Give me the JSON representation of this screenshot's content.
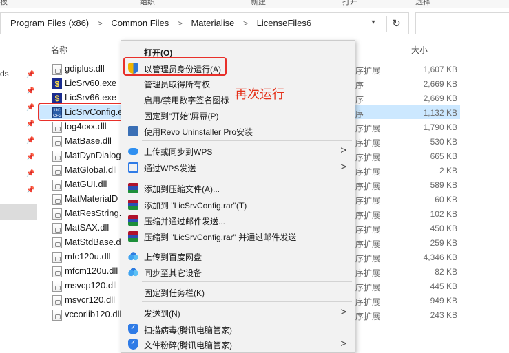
{
  "ribbon": {
    "items": [
      "板",
      "组织",
      "新建",
      "打开",
      "选择"
    ]
  },
  "address": {
    "crumbs": [
      "Program Files (x86)",
      "Common Files",
      "Materialise",
      "LicenseFiles6"
    ],
    "separator": ">",
    "dropdown_icon": "chevron-down-icon",
    "refresh_icon": "refresh-icon"
  },
  "nav": {
    "partial_label": "ds"
  },
  "columns": {
    "name": "名称",
    "size": "大小"
  },
  "files": [
    {
      "name": "gdiplus.dll",
      "icon": "dll-file-icon",
      "type": "序扩展",
      "size": "1,607 KB"
    },
    {
      "name": "LicSrv60.exe",
      "icon": "exe-file-icon",
      "type": "序",
      "size": "2,669 KB"
    },
    {
      "name": "LicSrv66.exe",
      "icon": "exe-file-icon",
      "type": "序",
      "size": "2,669 KB"
    },
    {
      "name": "LicSrvConfig.e",
      "icon": "licsrvconfig-icon",
      "type": "序",
      "size": "1,132 KB"
    },
    {
      "name": "log4cxx.dll",
      "icon": "dll-file-icon",
      "type": "序扩展",
      "size": "1,790 KB"
    },
    {
      "name": "MatBase.dll",
      "icon": "dll-file-icon",
      "type": "序扩展",
      "size": "530 KB"
    },
    {
      "name": "MatDynDialog",
      "icon": "dll-file-icon",
      "type": "序扩展",
      "size": "665 KB"
    },
    {
      "name": "MatGlobal.dll",
      "icon": "dll-file-icon",
      "type": "序扩展",
      "size": "2 KB"
    },
    {
      "name": "MatGUI.dll",
      "icon": "dll-file-icon",
      "type": "序扩展",
      "size": "589 KB"
    },
    {
      "name": "MatMaterialD",
      "icon": "dll-file-icon",
      "type": "序扩展",
      "size": "60 KB"
    },
    {
      "name": "MatResString.",
      "icon": "dll-file-icon",
      "type": "序扩展",
      "size": "102 KB"
    },
    {
      "name": "MatSAX.dll",
      "icon": "dll-file-icon",
      "type": "序扩展",
      "size": "450 KB"
    },
    {
      "name": "MatStdBase.d",
      "icon": "dll-file-icon",
      "type": "序扩展",
      "size": "259 KB"
    },
    {
      "name": "mfc120u.dll",
      "icon": "dll-file-icon",
      "type": "序扩展",
      "size": "4,346 KB"
    },
    {
      "name": "mfcm120u.dll",
      "icon": "dll-file-icon",
      "type": "序扩展",
      "size": "82 KB"
    },
    {
      "name": "msvcp120.dll",
      "icon": "dll-file-icon",
      "type": "序扩展",
      "size": "445 KB"
    },
    {
      "name": "msvcr120.dll",
      "icon": "dll-file-icon",
      "type": "序扩展",
      "size": "949 KB"
    },
    {
      "name": "vccorlib120.dll",
      "icon": "dll-file-icon",
      "type": "序扩展",
      "size": "243 KB"
    }
  ],
  "context_menu": {
    "items": [
      {
        "label": "打开(O)",
        "bold": true
      },
      {
        "label": "以管理员身份运行(A)",
        "icon": "uac-shield-icon"
      },
      {
        "label": "管理员取得所有权"
      },
      {
        "label": "启用/禁用数字签名图标"
      },
      {
        "label": "固定到\"开始\"屏幕(P)"
      },
      {
        "label": "使用Revo Uninstaller Pro安装",
        "icon": "revo-uninstaller-icon"
      },
      {
        "label": "上传或同步到WPS",
        "icon": "wps-cloud-icon",
        "submenu": true
      },
      {
        "label": "通过WPS发送",
        "icon": "share-icon",
        "submenu": true
      },
      {
        "label": "添加到压缩文件(A)...",
        "icon": "winrar-icon"
      },
      {
        "label": "添加到 \"LicSrvConfig.rar\"(T)",
        "icon": "winrar-icon"
      },
      {
        "label": "压缩并通过邮件发送...",
        "icon": "winrar-icon"
      },
      {
        "label": "压缩到 \"LicSrvConfig.rar\" 并通过邮件发送",
        "icon": "winrar-icon"
      },
      {
        "label": "上传到百度网盘",
        "icon": "baidu-netdisk-icon"
      },
      {
        "label": "同步至其它设备",
        "icon": "baidu-netdisk-icon"
      },
      {
        "label": "固定到任务栏(K)"
      },
      {
        "label": "发送到(N)",
        "submenu": true
      },
      {
        "label": "扫描病毒(腾讯电脑管家)",
        "icon": "tencent-guard-icon"
      },
      {
        "label": "文件粉碎(腾讯电脑管家)",
        "icon": "tencent-guard-icon",
        "submenu": true
      }
    ],
    "submenu_arrow": ">"
  },
  "annotation": {
    "text": "再次运行",
    "color": "#e4321b"
  },
  "colors": {
    "selection": "#cce8ff",
    "highlight_box": "#e8302a",
    "menu_bg": "#f2f2f2"
  }
}
